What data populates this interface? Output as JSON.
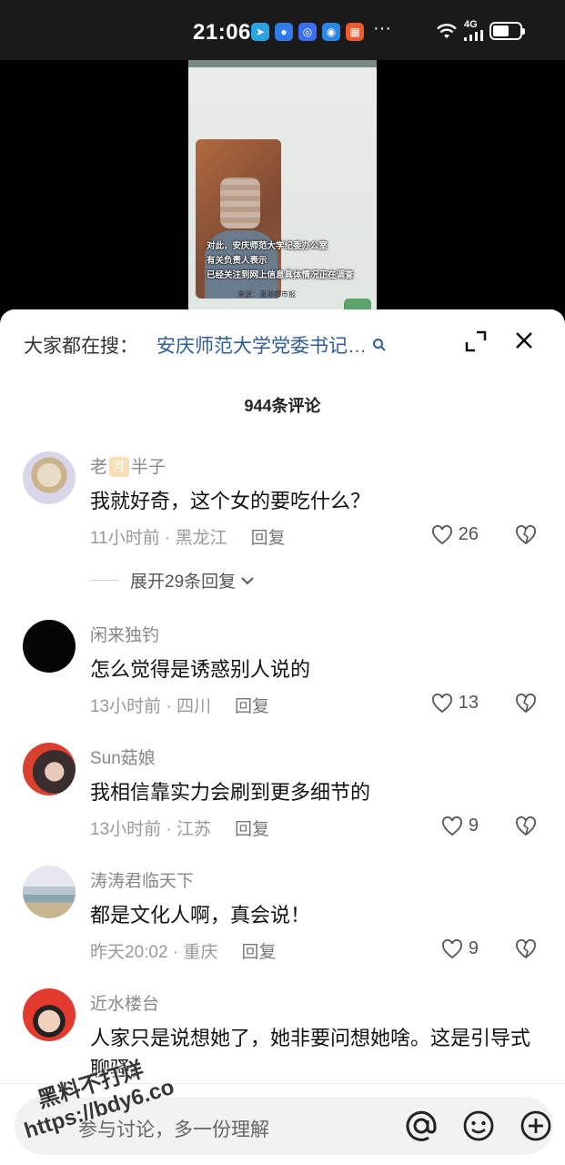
{
  "status_bar": {
    "time": "21:06",
    "more": "···",
    "network": "4G",
    "battery_level": 0.6,
    "app_icons": [
      "telegram-icon",
      "message-icon",
      "cast-icon",
      "browser-icon",
      "app-grid-icon"
    ]
  },
  "video": {
    "caption_lines": [
      "对此，安庆师范大学纪委办公室",
      "有关负责人表示",
      "已经关注到网上信息具体情况正在调查"
    ],
    "source": "来源：潇湘都市报"
  },
  "sheet": {
    "search_label": "大家都在搜：",
    "search_query": "安庆师范大学党委书记…",
    "comment_count": "944条评论"
  },
  "comments": [
    {
      "name_pre": "老",
      "name_badge": "月",
      "name_post": "半子",
      "text": "我就好奇，这个女的要吃什么？",
      "time": "11小时前",
      "location": "黑龙江",
      "reply_label": "回复",
      "likes": "26",
      "expand_label": "展开29条回复"
    },
    {
      "name": "闲来独钓",
      "text": "怎么觉得是诱惑别人说的",
      "time": "13小时前",
      "location": "四川",
      "reply_label": "回复",
      "likes": "13"
    },
    {
      "name": "Sun菇娘",
      "text": "我相信靠实力会刷到更多细节的",
      "time": "13小时前",
      "location": "江苏",
      "reply_label": "回复",
      "likes": "9"
    },
    {
      "name": "涛涛君临天下",
      "text": "都是文化人啊，真会说！",
      "time": "昨天20:02",
      "location": "重庆",
      "reply_label": "回复",
      "likes": "9"
    },
    {
      "name": "近水楼台",
      "text": "人家只是说想她了，她非要问想她啥。这是引导式聊骚。"
    }
  ],
  "input_bar": {
    "placeholder": "参与讨论，多一份理解"
  },
  "watermark": {
    "line1": "黑料不打烊",
    "line2": "https://bdy6.co"
  }
}
